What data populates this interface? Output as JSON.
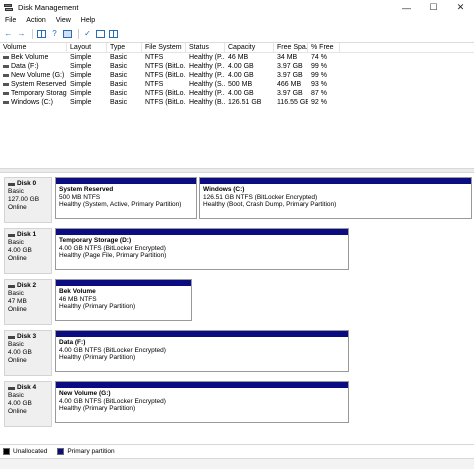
{
  "window": {
    "title": "Disk Management",
    "controls": {
      "minimize": "—",
      "maximize": "☐",
      "close": "✕"
    }
  },
  "menu": [
    "File",
    "Action",
    "View",
    "Help"
  ],
  "volumes": {
    "columns": [
      "Volume",
      "Layout",
      "Type",
      "File System",
      "Status",
      "Capacity",
      "Free Spa...",
      "% Free"
    ],
    "rows": [
      [
        "Bek Volume",
        "Simple",
        "Basic",
        "NTFS",
        "Healthy (P...",
        "46 MB",
        "34 MB",
        "74 %"
      ],
      [
        "Data (F:)",
        "Simple",
        "Basic",
        "NTFS (BitLo...",
        "Healthy (P...",
        "4.00 GB",
        "3.97 GB",
        "99 %"
      ],
      [
        "New Volume (G:)",
        "Simple",
        "Basic",
        "NTFS (BitLo...",
        "Healthy (P...",
        "4.00 GB",
        "3.97 GB",
        "99 %"
      ],
      [
        "System Reserved",
        "Simple",
        "Basic",
        "NTFS",
        "Healthy (S...",
        "500 MB",
        "466 MB",
        "93 %"
      ],
      [
        "Temporary Storag...",
        "Simple",
        "Basic",
        "NTFS (BitLo...",
        "Healthy (P...",
        "4.00 GB",
        "3.97 GB",
        "87 %"
      ],
      [
        "Windows (C:)",
        "Simple",
        "Basic",
        "NTFS (BitLo...",
        "Healthy (B...",
        "126.51 GB",
        "116.55 GB",
        "92 %"
      ]
    ]
  },
  "disks": [
    {
      "name": "Disk 0",
      "type": "Basic",
      "size": "127.00 GB",
      "status": "Online",
      "partitions": [
        {
          "name": "System Reserved",
          "detail": "500 MB NTFS",
          "health": "Healthy (System, Active, Primary Partition)"
        },
        {
          "name": "Windows  (C:)",
          "detail": "126.51 GB NTFS (BitLocker Encrypted)",
          "health": "Healthy (Boot, Crash Dump, Primary Partition)"
        }
      ]
    },
    {
      "name": "Disk 1",
      "type": "Basic",
      "size": "4.00 GB",
      "status": "Online",
      "partitions": [
        {
          "name": "Temporary Storage  (D:)",
          "detail": "4.00 GB NTFS (BitLocker Encrypted)",
          "health": "Healthy (Page File, Primary Partition)"
        }
      ]
    },
    {
      "name": "Disk 2",
      "type": "Basic",
      "size": "47 MB",
      "status": "Online",
      "partitions": [
        {
          "name": "Bek Volume",
          "detail": "46 MB NTFS",
          "health": "Healthy (Primary Partition)"
        }
      ]
    },
    {
      "name": "Disk 3",
      "type": "Basic",
      "size": "4.00 GB",
      "status": "Online",
      "partitions": [
        {
          "name": "Data  (F:)",
          "detail": "4.00 GB NTFS (BitLocker Encrypted)",
          "health": "Healthy (Primary Partition)"
        }
      ]
    },
    {
      "name": "Disk 4",
      "type": "Basic",
      "size": "4.00 GB",
      "status": "Online",
      "partitions": [
        {
          "name": "New Volume  (G:)",
          "detail": "4.00 GB NTFS (BitLocker Encrypted)",
          "health": "Healthy (Primary Partition)"
        }
      ]
    }
  ],
  "legend": {
    "unallocated": "Unallocated",
    "unallocated_color": "#000000",
    "primary": "Primary partition",
    "primary_color": "#0b0b82"
  },
  "colors": {
    "partition_bar": "#0b0b82"
  }
}
